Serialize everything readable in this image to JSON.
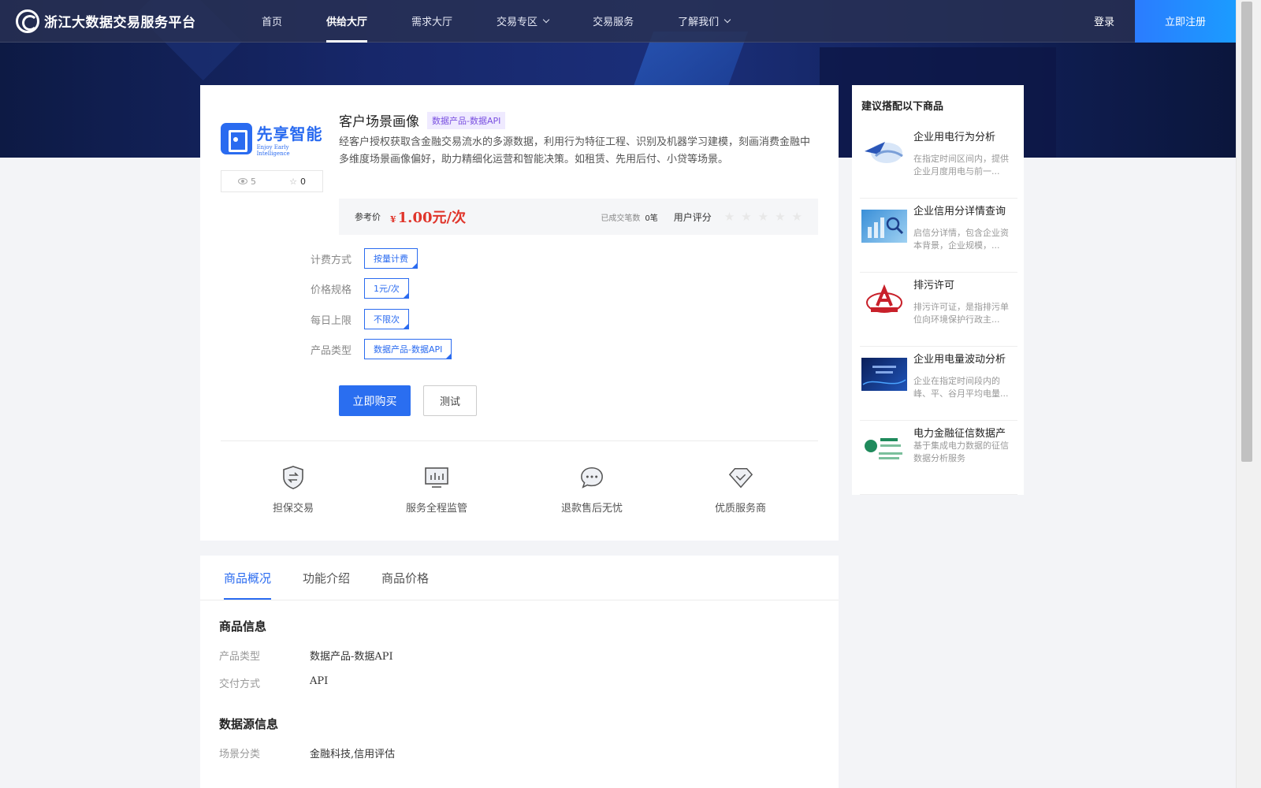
{
  "nav": {
    "logo_text": "浙江大数据交易服务平台",
    "items": [
      {
        "label": "首页"
      },
      {
        "label": "供给大厅"
      },
      {
        "label": "需求大厅"
      },
      {
        "label": "交易专区"
      },
      {
        "label": "交易服务"
      },
      {
        "label": "了解我们"
      }
    ],
    "login": "登录",
    "register": "立即注册"
  },
  "company": {
    "logo_cn": "先享智能",
    "logo_en": "Enjoy Early Intelligence",
    "views": "5",
    "favorites": "0"
  },
  "product": {
    "title": "客户场景画像",
    "tag": "数据产品-数据API",
    "description": "经客户授权获取含金融交易流水的多源数据，利用行为特征工程、识别及机器学习建模，刻画消费金融中多维度场景画像偏好，助力精细化运营和智能决策。如租赁、先用后付、小贷等场景。",
    "price_label": "参考价",
    "currency": "¥",
    "price": "1.00元/次",
    "deals_label": "已成交笔数",
    "deals_value": "0笔",
    "rating_label": "用户评分",
    "rating": 0,
    "specs": [
      {
        "label": "计费方式",
        "value": "按量计费"
      },
      {
        "label": "价格规格",
        "value": "1元/次"
      },
      {
        "label": "每日上限",
        "value": "不限次"
      },
      {
        "label": "产品类型",
        "value": "数据产品-数据API"
      }
    ],
    "buy_label": "立即购买",
    "test_label": "测试"
  },
  "features": [
    {
      "label": "担保交易",
      "icon": "shield-exchange-icon"
    },
    {
      "label": "服务全程监管",
      "icon": "monitor-chart-icon"
    },
    {
      "label": "退款售后无忧",
      "icon": "chat-bubble-icon"
    },
    {
      "label": "优质服务商",
      "icon": "diamond-check-icon"
    }
  ],
  "recommend": {
    "title": "建议搭配以下商品",
    "items": [
      {
        "name": "企业用电行为分析",
        "desc": "在指定时间区间内，提供企业月度用电与前一..."
      },
      {
        "name": "企业信用分详情查询",
        "desc": "启信分详情，包含企业资本背景，企业规模，..."
      },
      {
        "name": "排污许可",
        "desc": "排污许可证，是指排污单位向环境保护行政主..."
      },
      {
        "name": "企业用电量波动分析",
        "desc": "企业在指定时间段内的峰、平、谷月平均电量..."
      },
      {
        "name": "电力金融征信数据产",
        "desc": "基于集成电力数据的征信数据分析服务"
      }
    ]
  },
  "tabs": [
    {
      "label": "商品概况"
    },
    {
      "label": "功能介绍"
    },
    {
      "label": "商品价格"
    }
  ],
  "detail": {
    "product_info_title": "商品信息",
    "product_type_key": "产品类型",
    "product_type_val": "数据产品-数据API",
    "delivery_key": "交付方式",
    "delivery_val": "API",
    "source_title": "数据源信息",
    "scene_key": "场景分类",
    "scene_val": "金融科技,信用评估"
  },
  "colors": {
    "accent": "#2a6bf0",
    "price": "#e0352b",
    "nav_bg": "#283054",
    "hero_bg": "#17276a"
  }
}
